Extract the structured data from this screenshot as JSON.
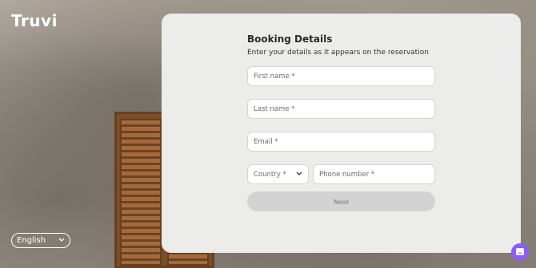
{
  "brand": {
    "logo_text": "Truvi"
  },
  "language": {
    "selected": "English"
  },
  "form": {
    "title": "Booking Details",
    "subtitle": "Enter your details as it appears on the reservation",
    "first_name_placeholder": "First name *",
    "last_name_placeholder": "Last name *",
    "email_placeholder": "Email *",
    "country_placeholder": "Country *",
    "phone_placeholder": "Phone number *",
    "next_label": "Next"
  },
  "icons": {
    "chevron": "chevron-down-icon",
    "chat": "chat-icon"
  },
  "colors": {
    "card_bg": "#ececeb",
    "button_disabled_bg": "#d3d3d3",
    "chat_accent": "#8b5cf6"
  }
}
